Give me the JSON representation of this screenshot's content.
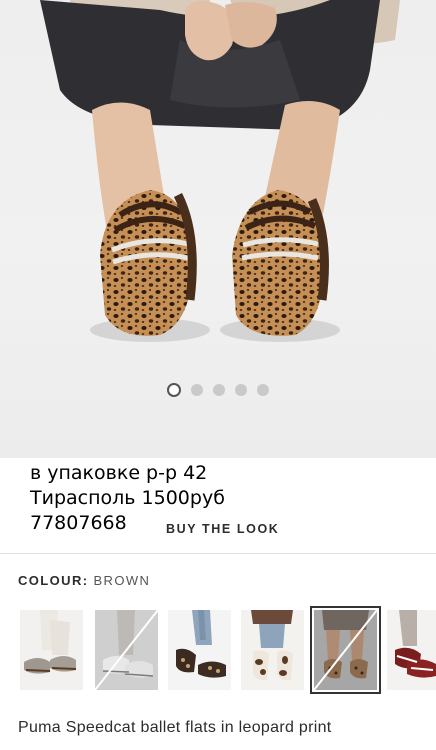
{
  "hero": {
    "carousel": {
      "total": 5,
      "active_index": 0
    }
  },
  "overlay": {
    "line1": "в упаковке р-р 42",
    "line2": "Тирасполь 1500руб",
    "line3": "77807668"
  },
  "buy_the_look": "BUY THE LOOK",
  "colour": {
    "label": "COLOUR:",
    "value": "BROWN"
  },
  "swatches": [
    {
      "name": "grey suede",
      "selected": false,
      "unavailable": false
    },
    {
      "name": "light grey",
      "selected": false,
      "unavailable": true
    },
    {
      "name": "black white",
      "selected": false,
      "unavailable": false
    },
    {
      "name": "white cow print",
      "selected": false,
      "unavailable": false
    },
    {
      "name": "brown leopard",
      "selected": true,
      "unavailable": true
    },
    {
      "name": "red",
      "selected": false,
      "unavailable": false
    }
  ],
  "product": {
    "name": "Puma Speedcat ballet flats in leopard print"
  }
}
